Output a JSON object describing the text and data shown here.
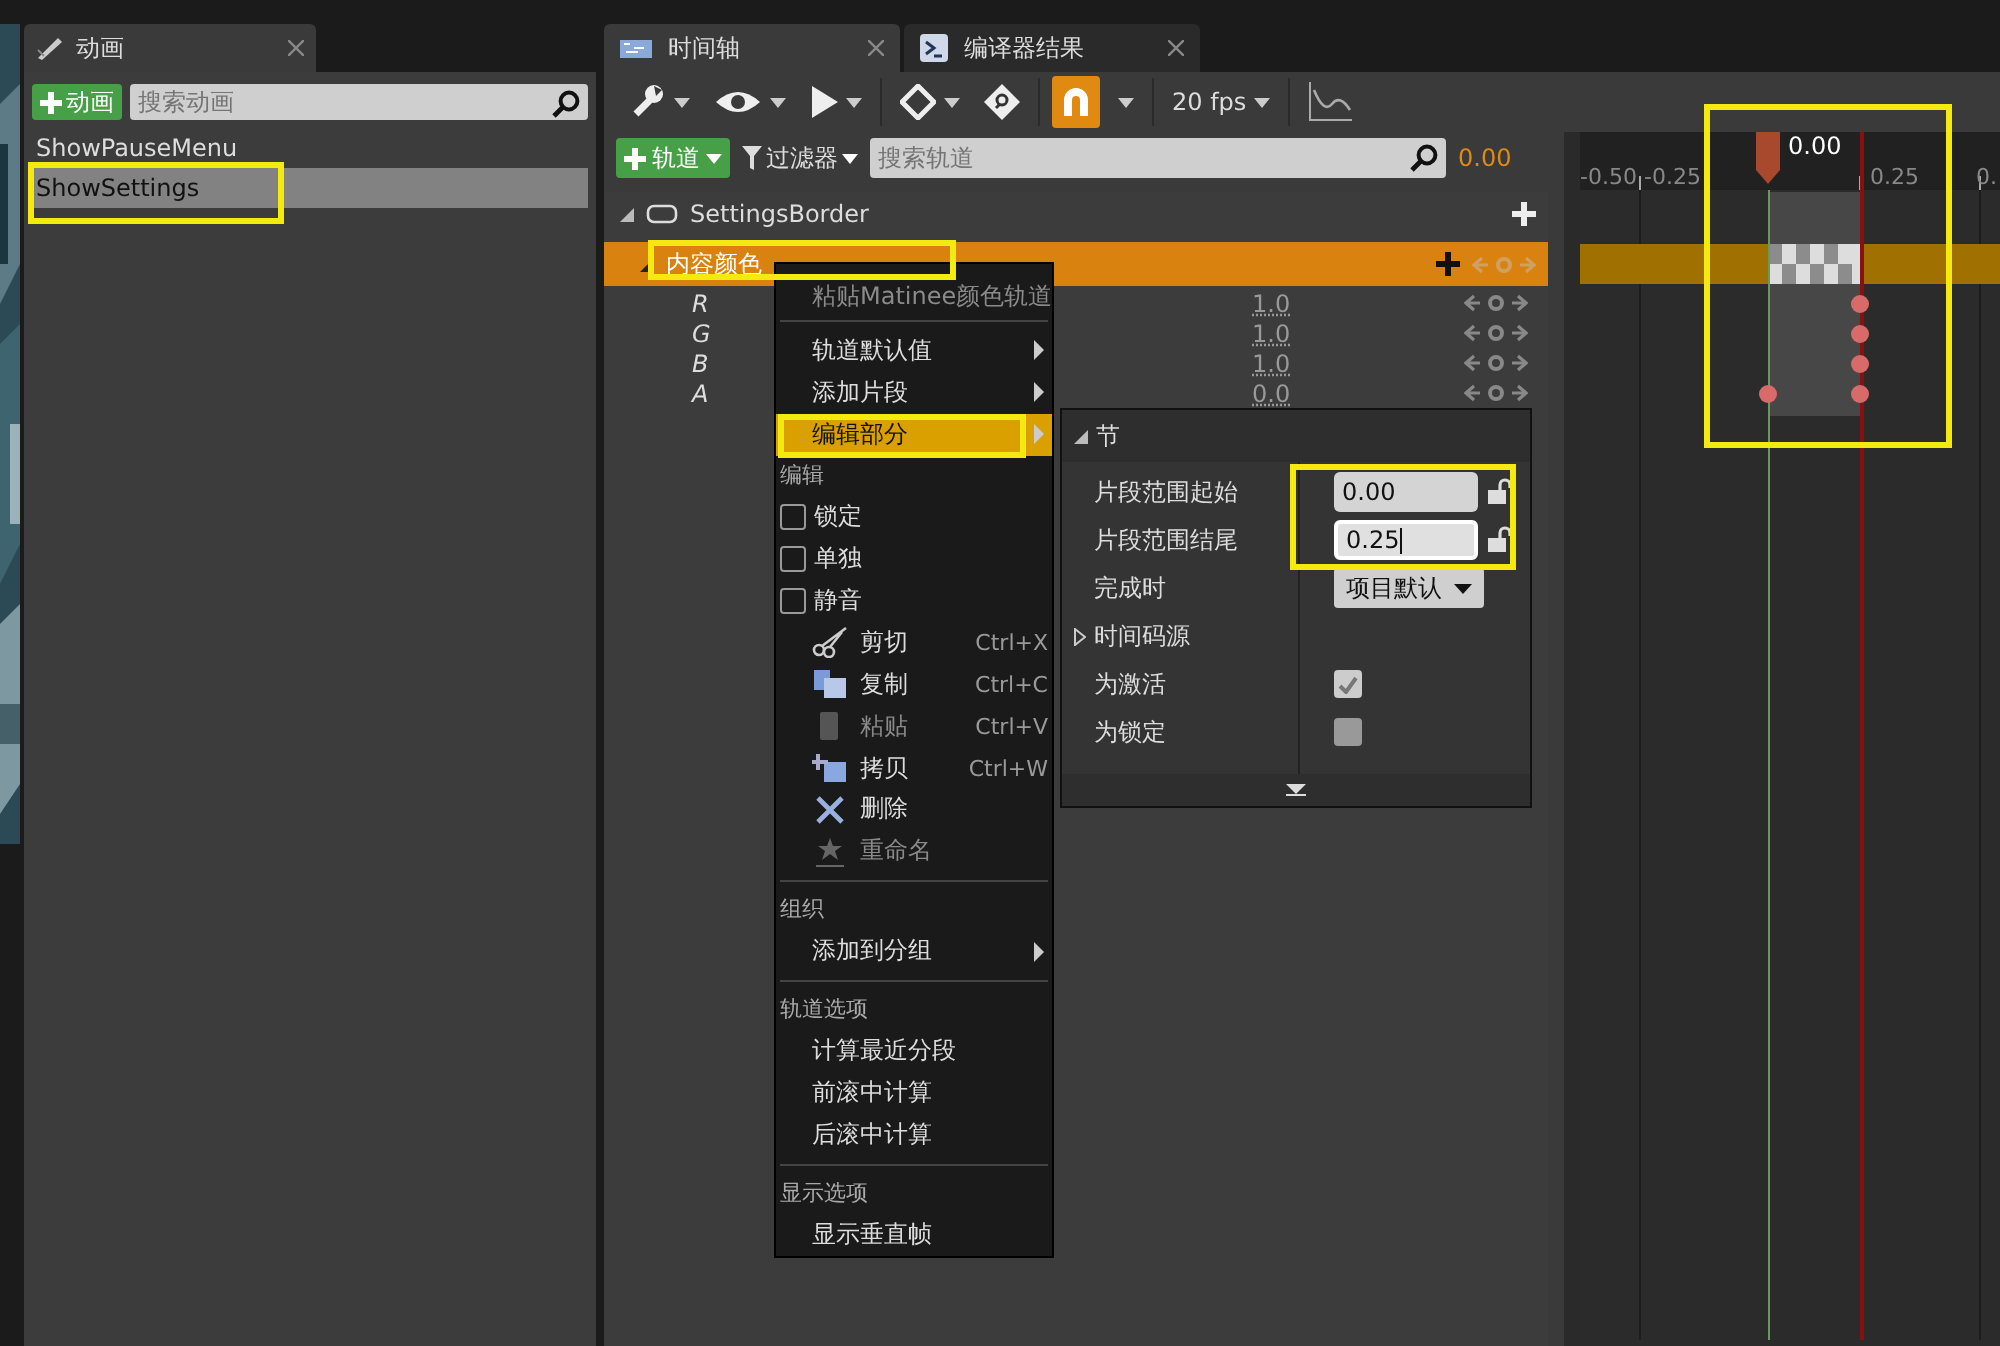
{
  "left_panel": {
    "tab": {
      "title": "动画",
      "selected": true
    },
    "add_button": "动画",
    "search": {
      "placeholder": "搜索动画"
    },
    "animations": [
      {
        "name": "ShowPauseMenu",
        "selected": false,
        "marked": false
      },
      {
        "name": "ShowSettings",
        "selected": true,
        "marked": true
      }
    ]
  },
  "editor_tabs": [
    {
      "title": "时间轴",
      "selected": true
    },
    {
      "title": "编译器结果",
      "selected": false
    }
  ],
  "toolbar": {
    "snap": {
      "on": true
    },
    "fps": "20 fps"
  },
  "track_bar": {
    "add_button": "轨道",
    "filter_button": "过滤器",
    "search": {
      "placeholder": "搜索轨道"
    },
    "time": "0.00"
  },
  "tracks": [
    {
      "name": "SettingsBorder",
      "expanded": true,
      "children": [
        {
          "name": "内容颜色",
          "expanded": true,
          "selected": true,
          "marked": true,
          "channels": [
            {
              "name": "R",
              "value": "1.0"
            },
            {
              "name": "G",
              "value": "1.0"
            },
            {
              "name": "B",
              "value": "1.0"
            },
            {
              "name": "A",
              "value": "0.0"
            }
          ]
        }
      ]
    }
  ],
  "timeline": {
    "ruler": [
      "-0.50",
      "-0.25",
      "0.25",
      "0."
    ],
    "playhead": "0.00",
    "marked": true
  },
  "context_menu": {
    "items": [
      {
        "kind": "item",
        "label": "粘贴Matinee颜色轨道",
        "disabled": true,
        "submenu": false,
        "selected": false
      },
      {
        "kind": "separator"
      },
      {
        "kind": "item",
        "label": "轨道默认值",
        "disabled": false,
        "submenu": true,
        "selected": false
      },
      {
        "kind": "item",
        "label": "添加片段",
        "disabled": false,
        "submenu": true,
        "selected": false
      },
      {
        "kind": "item",
        "label": "编辑部分",
        "disabled": false,
        "submenu": true,
        "selected": true,
        "marked": true
      },
      {
        "kind": "heading",
        "label": "编辑"
      },
      {
        "kind": "check",
        "label": "锁定",
        "checked": false
      },
      {
        "kind": "check",
        "label": "单独",
        "checked": false
      },
      {
        "kind": "check",
        "label": "静音",
        "checked": false
      },
      {
        "kind": "command",
        "label": "剪切",
        "shortcut": "Ctrl+X",
        "disabled": false
      },
      {
        "kind": "command",
        "label": "复制",
        "shortcut": "Ctrl+C",
        "disabled": false
      },
      {
        "kind": "command",
        "label": "粘贴",
        "shortcut": "Ctrl+V",
        "disabled": true
      },
      {
        "kind": "command",
        "label": "拷贝",
        "shortcut": "Ctrl+W",
        "disabled": false
      },
      {
        "kind": "command",
        "label": "删除",
        "disabled": false
      },
      {
        "kind": "command",
        "label": "重命名",
        "disabled": true
      },
      {
        "kind": "separator"
      },
      {
        "kind": "heading",
        "label": "组织"
      },
      {
        "kind": "item",
        "label": "添加到分组",
        "disabled": false,
        "submenu": true,
        "selected": false
      },
      {
        "kind": "separator"
      },
      {
        "kind": "heading",
        "label": "轨道选项"
      },
      {
        "kind": "item",
        "label": "计算最近分段",
        "disabled": false,
        "submenu": false,
        "selected": false
      },
      {
        "kind": "item",
        "label": "前滚中计算",
        "disabled": false,
        "submenu": false,
        "selected": false
      },
      {
        "kind": "item",
        "label": "后滚中计算",
        "disabled": false,
        "submenu": false,
        "selected": false
      },
      {
        "kind": "separator"
      },
      {
        "kind": "heading",
        "label": "显示选项"
      },
      {
        "kind": "item",
        "label": "显示垂直帧",
        "disabled": false,
        "submenu": false,
        "selected": false
      }
    ]
  },
  "details": {
    "section": "节",
    "expanded": true,
    "range_marked": true,
    "rows": [
      {
        "kind": "field",
        "label": "片段范围起始",
        "value": "0.00",
        "focused": false
      },
      {
        "kind": "field",
        "label": "片段范围结尾",
        "value": "0.25",
        "focused": true
      },
      {
        "kind": "dropdown",
        "label": "完成时",
        "value": "项目默认"
      },
      {
        "kind": "group",
        "label": "时间码源",
        "expanded": false
      },
      {
        "kind": "check",
        "label": "为激活",
        "checked": true
      },
      {
        "kind": "check",
        "label": "为锁定",
        "checked": false
      }
    ]
  }
}
